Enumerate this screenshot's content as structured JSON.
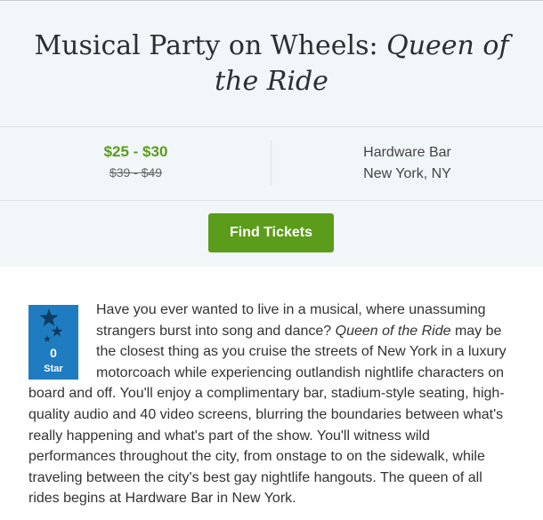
{
  "event": {
    "title_prefix": "Musical Party on Wheels: ",
    "title_italic": "Queen of the Ride"
  },
  "pricing": {
    "current": "$25 - $30",
    "original": "$39 - $49"
  },
  "venue": {
    "name": "Hardware Bar",
    "location": "New York, NY"
  },
  "actions": {
    "find_tickets_label": "Find Tickets"
  },
  "rating_badge": {
    "value": "0",
    "label": "Star",
    "icon": "stars-icon"
  },
  "description": {
    "part1": "Have you ever wanted to live in a musical, where unassuming strangers burst into song and dance? ",
    "italic": "Queen of the Ride",
    "part2": " may be the closest thing as you cruise the streets of New York in a luxury motorcoach while experiencing outlandish nightlife characters on board and off. You'll enjoy a complimentary bar, stadium-style seating, high-quality audio and 40 video screens, blurring the boundaries between what's really happening and what's part of the show. You'll witness wild performances throughout the city, from onstage to on the sidewalk, while traveling between the city's best gay nightlife hangouts. The queen of all rides begins at Hardware Bar in New York."
  },
  "colors": {
    "accent_green": "#5b9c1a",
    "badge_blue": "#1f7cc0",
    "hero_background": "#f1f6f8"
  }
}
